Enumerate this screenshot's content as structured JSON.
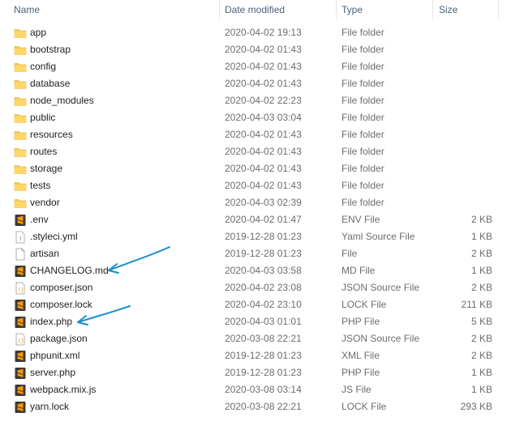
{
  "columns": {
    "name": "Name",
    "date": "Date modified",
    "type": "Type",
    "size": "Size"
  },
  "colors": {
    "folder": "#f6c851",
    "sublime": "#ff9800",
    "arrow": "#1a8fd1"
  },
  "files": [
    {
      "name": "app",
      "date": "2020-04-02 19:13",
      "type": "File folder",
      "size": "",
      "icon": "folder-icon"
    },
    {
      "name": "bootstrap",
      "date": "2020-04-02 01:43",
      "type": "File folder",
      "size": "",
      "icon": "folder-icon"
    },
    {
      "name": "config",
      "date": "2020-04-02 01:43",
      "type": "File folder",
      "size": "",
      "icon": "folder-icon"
    },
    {
      "name": "database",
      "date": "2020-04-02 01:43",
      "type": "File folder",
      "size": "",
      "icon": "folder-icon"
    },
    {
      "name": "node_modules",
      "date": "2020-04-02 22:23",
      "type": "File folder",
      "size": "",
      "icon": "folder-icon"
    },
    {
      "name": "public",
      "date": "2020-04-03 03:04",
      "type": "File folder",
      "size": "",
      "icon": "folder-icon"
    },
    {
      "name": "resources",
      "date": "2020-04-02 01:43",
      "type": "File folder",
      "size": "",
      "icon": "folder-icon"
    },
    {
      "name": "routes",
      "date": "2020-04-02 01:43",
      "type": "File folder",
      "size": "",
      "icon": "folder-icon"
    },
    {
      "name": "storage",
      "date": "2020-04-02 01:43",
      "type": "File folder",
      "size": "",
      "icon": "folder-icon"
    },
    {
      "name": "tests",
      "date": "2020-04-02 01:43",
      "type": "File folder",
      "size": "",
      "icon": "folder-icon"
    },
    {
      "name": "vendor",
      "date": "2020-04-03 02:39",
      "type": "File folder",
      "size": "",
      "icon": "folder-icon"
    },
    {
      "name": ".env",
      "date": "2020-04-02 01:47",
      "type": "ENV File",
      "size": "2 KB",
      "icon": "sublime-text-file-icon"
    },
    {
      "name": ".styleci.yml",
      "date": "2019-12-28 01:23",
      "type": "Yaml Source File",
      "size": "1 KB",
      "icon": "text-file-icon"
    },
    {
      "name": "artisan",
      "date": "2019-12-28 01:23",
      "type": "File",
      "size": "2 KB",
      "icon": "blank-file-icon"
    },
    {
      "name": "CHANGELOG.md",
      "date": "2020-04-03 03:58",
      "type": "MD File",
      "size": "1 KB",
      "icon": "sublime-text-file-icon"
    },
    {
      "name": "composer.json",
      "date": "2020-04-02 23:08",
      "type": "JSON Source File",
      "size": "2 KB",
      "icon": "json-file-icon"
    },
    {
      "name": "composer.lock",
      "date": "2020-04-02 23:10",
      "type": "LOCK File",
      "size": "211 KB",
      "icon": "sublime-text-file-icon"
    },
    {
      "name": "index.php",
      "date": "2020-04-03 01:01",
      "type": "PHP File",
      "size": "5 KB",
      "icon": "sublime-text-file-icon"
    },
    {
      "name": "package.json",
      "date": "2020-03-08 22:21",
      "type": "JSON Source File",
      "size": "2 KB",
      "icon": "json-file-icon"
    },
    {
      "name": "phpunit.xml",
      "date": "2019-12-28 01:23",
      "type": "XML File",
      "size": "2 KB",
      "icon": "sublime-text-file-icon"
    },
    {
      "name": "server.php",
      "date": "2019-12-28 01:23",
      "type": "PHP File",
      "size": "1 KB",
      "icon": "sublime-text-file-icon"
    },
    {
      "name": "webpack.mix.js",
      "date": "2020-03-08 03:14",
      "type": "JS File",
      "size": "1 KB",
      "icon": "sublime-text-file-icon"
    },
    {
      "name": "yarn.lock",
      "date": "2020-03-08 22:21",
      "type": "LOCK File",
      "size": "293 KB",
      "icon": "sublime-text-file-icon"
    }
  ],
  "annotations": [
    {
      "icon": "arrow-icon",
      "target": "CHANGELOG.md"
    },
    {
      "icon": "arrow-icon",
      "target": "index.php"
    }
  ]
}
